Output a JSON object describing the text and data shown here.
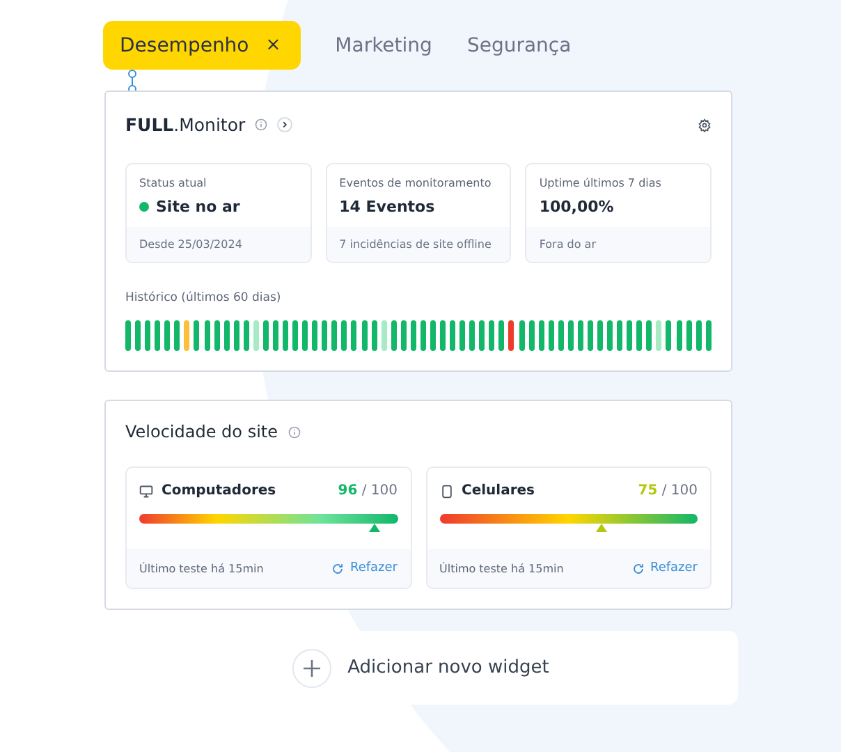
{
  "tabs": [
    {
      "label": "Desempenho",
      "selected": true,
      "close": "×"
    },
    {
      "label": "Marketing",
      "selected": false
    },
    {
      "label": "Segurança",
      "selected": false
    }
  ],
  "monitor": {
    "title_bold": "FULL",
    "title_rest": ".Monitor",
    "stats": [
      {
        "label": "Status atual",
        "value": "Site no ar",
        "color": "#12b76a",
        "footer": "Desde 25/03/2024"
      },
      {
        "label": "Eventos de monitoramento",
        "value": "14 Eventos",
        "footer": "7 incidências de site offline"
      },
      {
        "label": "Uptime últimos 7 dias",
        "value": "100,00%",
        "footer": "Fora do ar"
      }
    ],
    "history_label": "Histórico (últimos 60 dias)",
    "history": [
      {
        "color": "#12b76a"
      },
      {
        "color": "#12b76a"
      },
      {
        "color": "#12b76a"
      },
      {
        "color": "#12b76a"
      },
      {
        "color": "#12b76a"
      },
      {
        "color": "#12b76a"
      },
      {
        "color": "#fbbf3c"
      },
      {
        "color": "#12b76a"
      },
      {
        "color": "#12b76a"
      },
      {
        "color": "#12b76a"
      },
      {
        "color": "#12b76a"
      },
      {
        "color": "#12b76a"
      },
      {
        "color": "#12b76a"
      },
      {
        "color": "#a6ebc3"
      },
      {
        "color": "#12b76a"
      },
      {
        "color": "#12b76a"
      },
      {
        "color": "#12b76a"
      },
      {
        "color": "#12b76a"
      },
      {
        "color": "#12b76a"
      },
      {
        "color": "#12b76a"
      },
      {
        "color": "#12b76a"
      },
      {
        "color": "#12b76a"
      },
      {
        "color": "#12b76a"
      },
      {
        "color": "#12b76a"
      },
      {
        "color": "#12b76a"
      },
      {
        "color": "#12b76a"
      },
      {
        "color": "#a6ebc3"
      },
      {
        "color": "#12b76a"
      },
      {
        "color": "#12b76a"
      },
      {
        "color": "#12b76a"
      },
      {
        "color": "#12b76a"
      },
      {
        "color": "#12b76a"
      },
      {
        "color": "#12b76a"
      },
      {
        "color": "#12b76a"
      },
      {
        "color": "#12b76a"
      },
      {
        "color": "#12b76a"
      },
      {
        "color": "#12b76a"
      },
      {
        "color": "#12b76a"
      },
      {
        "color": "#12b76a"
      },
      {
        "color": "#ef3b2d"
      },
      {
        "color": "#12b76a"
      },
      {
        "color": "#12b76a"
      },
      {
        "color": "#12b76a"
      },
      {
        "color": "#12b76a"
      },
      {
        "color": "#12b76a"
      },
      {
        "color": "#12b76a"
      },
      {
        "color": "#12b76a"
      },
      {
        "color": "#12b76a"
      },
      {
        "color": "#12b76a"
      },
      {
        "color": "#12b76a"
      },
      {
        "color": "#12b76a"
      },
      {
        "color": "#12b76a"
      },
      {
        "color": "#12b76a"
      },
      {
        "color": "#12b76a"
      },
      {
        "color": "#a6ebc3"
      },
      {
        "color": "#12b76a"
      },
      {
        "color": "#12b76a"
      },
      {
        "color": "#12b76a"
      },
      {
        "color": "#12b76a"
      },
      {
        "color": "#12b76a"
      }
    ]
  },
  "speed": {
    "title": "Velocidade do site",
    "devices": [
      {
        "kind": "desktop",
        "name": "Computadores",
        "score": "96",
        "max": "/ 100",
        "color": "#12b76a",
        "level": 0.91,
        "last_test": "Último teste há 15min",
        "redo": "Refazer"
      },
      {
        "kind": "mobile",
        "name": "Celulares",
        "score": "75",
        "max": "/ 100",
        "color": "#b5c80f",
        "level": 0.63,
        "last_test": "Último teste há 15min",
        "redo": "Refazer"
      }
    ]
  },
  "add_widget": {
    "label": "Adicionar novo widget"
  }
}
